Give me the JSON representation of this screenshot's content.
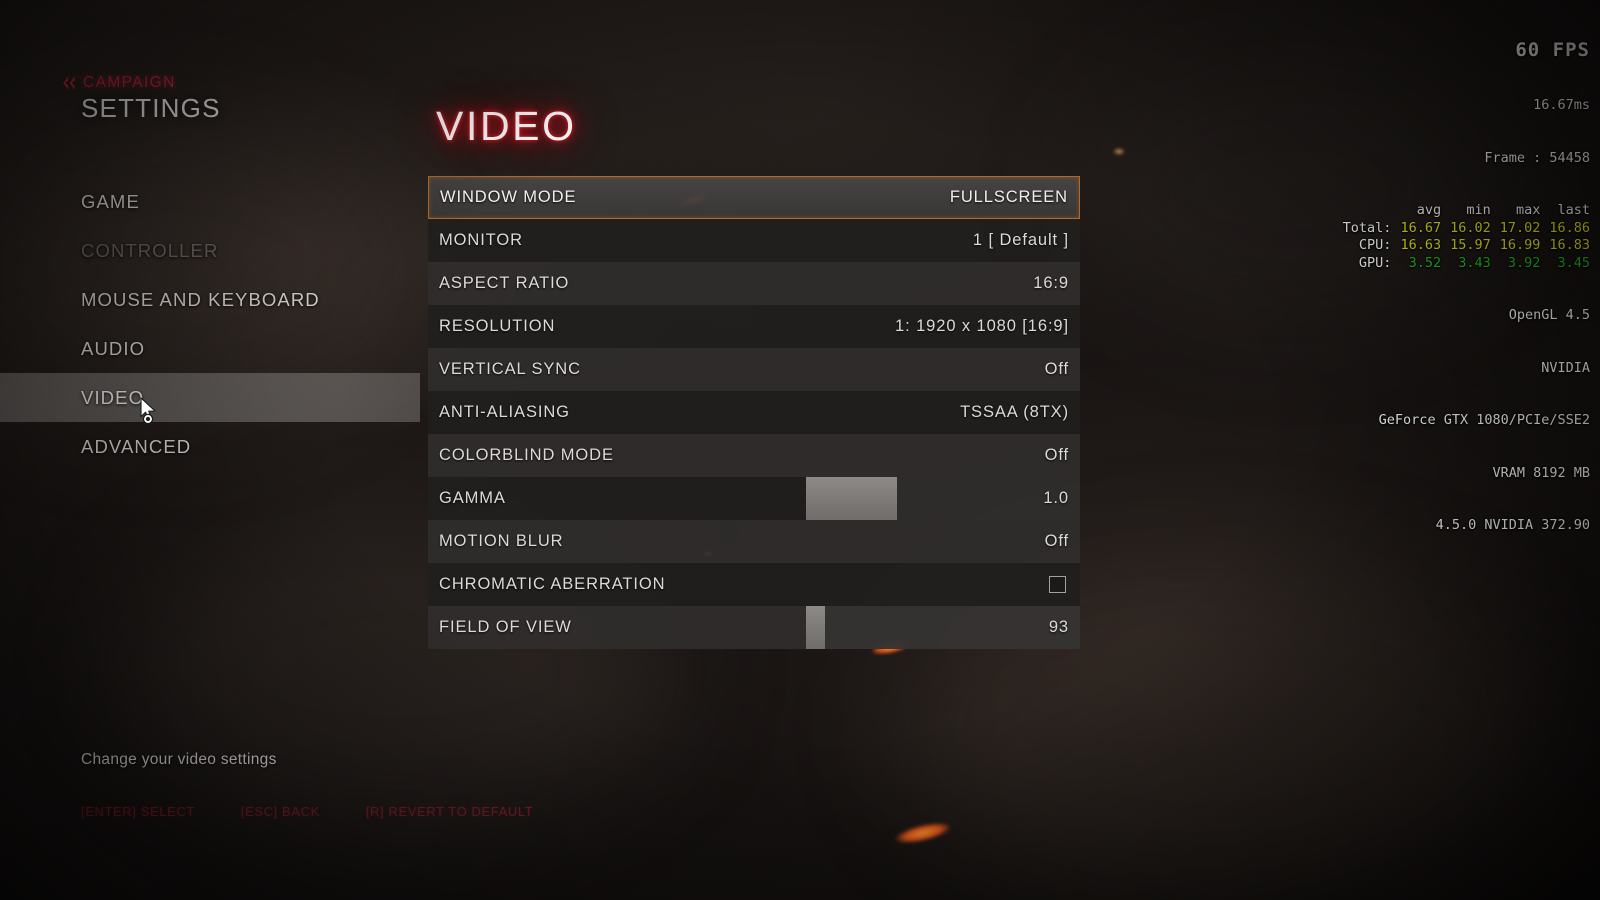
{
  "sidebar": {
    "back": {
      "label": "CAMPAIGN",
      "icon": "double-chevron-left-icon"
    },
    "title": "SETTINGS",
    "items": [
      {
        "label": "GAME",
        "state": "normal"
      },
      {
        "label": "CONTROLLER",
        "state": "disabled"
      },
      {
        "label": "MOUSE AND KEYBOARD",
        "state": "normal"
      },
      {
        "label": "AUDIO",
        "state": "normal"
      },
      {
        "label": "VIDEO",
        "state": "active"
      },
      {
        "label": "ADVANCED",
        "state": "normal"
      }
    ]
  },
  "panel": {
    "title": "VIDEO",
    "options": [
      {
        "label": "WINDOW MODE",
        "value": "FULLSCREEN",
        "type": "value",
        "selected": true
      },
      {
        "label": "MONITOR",
        "value": "1 [ Default ]",
        "type": "value",
        "selected": false
      },
      {
        "label": "ASPECT RATIO",
        "value": "16:9",
        "type": "value",
        "selected": false
      },
      {
        "label": "RESOLUTION",
        "value": "1: 1920 x 1080 [16:9]",
        "type": "value",
        "selected": false
      },
      {
        "label": "VERTICAL SYNC",
        "value": "Off",
        "type": "value",
        "selected": false
      },
      {
        "label": "ANTI-ALIASING",
        "value": "TSSAA (8TX)",
        "type": "value",
        "selected": false
      },
      {
        "label": "COLORBLIND MODE",
        "value": "Off",
        "type": "value",
        "selected": false
      },
      {
        "label": "GAMMA",
        "value": "1.0",
        "type": "slider",
        "fill_pct": 33,
        "selected": false
      },
      {
        "label": "MOTION BLUR",
        "value": "Off",
        "type": "value",
        "selected": false
      },
      {
        "label": "CHROMATIC ABERRATION",
        "value": "",
        "type": "checkbox",
        "checked": false,
        "selected": false
      },
      {
        "label": "FIELD OF VIEW",
        "value": "93",
        "type": "slider",
        "fill_pct": 7,
        "selected": false
      }
    ]
  },
  "footer": {
    "description": "Change your video settings",
    "hints": [
      {
        "label": "[ENTER] SELECT"
      },
      {
        "label": "[ESC] BACK"
      },
      {
        "label": "[R] REVERT TO DEFAULT"
      }
    ]
  },
  "perf_overlay": {
    "fps": "60 FPS",
    "frametime": "16.67ms",
    "frame": "Frame : 54458",
    "columns": [
      "avg",
      "min",
      "max",
      "last"
    ],
    "rows": [
      {
        "name": "Total:",
        "color": "#e8e81c",
        "values": [
          "16.67",
          "16.02",
          "17.02",
          "16.86"
        ]
      },
      {
        "name": "CPU:",
        "color": "#e8e81c",
        "values": [
          "16.63",
          "15.97",
          "16.99",
          "16.83"
        ]
      },
      {
        "name": "GPU:",
        "color": "#23c423",
        "values": [
          "3.52",
          "3.43",
          "3.92",
          "3.45"
        ]
      }
    ],
    "api": "OpenGL 4.5",
    "vendor": "NVIDIA",
    "renderer": "GeForce GTX 1080/PCIe/SSE2",
    "vram": "VRAM 8192 MB",
    "driver": "4.5.0 NVIDIA 372.90"
  },
  "colors": {
    "accent_red": "#c4243a",
    "selection_orange": "#b06a2c",
    "hint_red": "#8e2231",
    "text_primary": "#ddd9d7"
  }
}
